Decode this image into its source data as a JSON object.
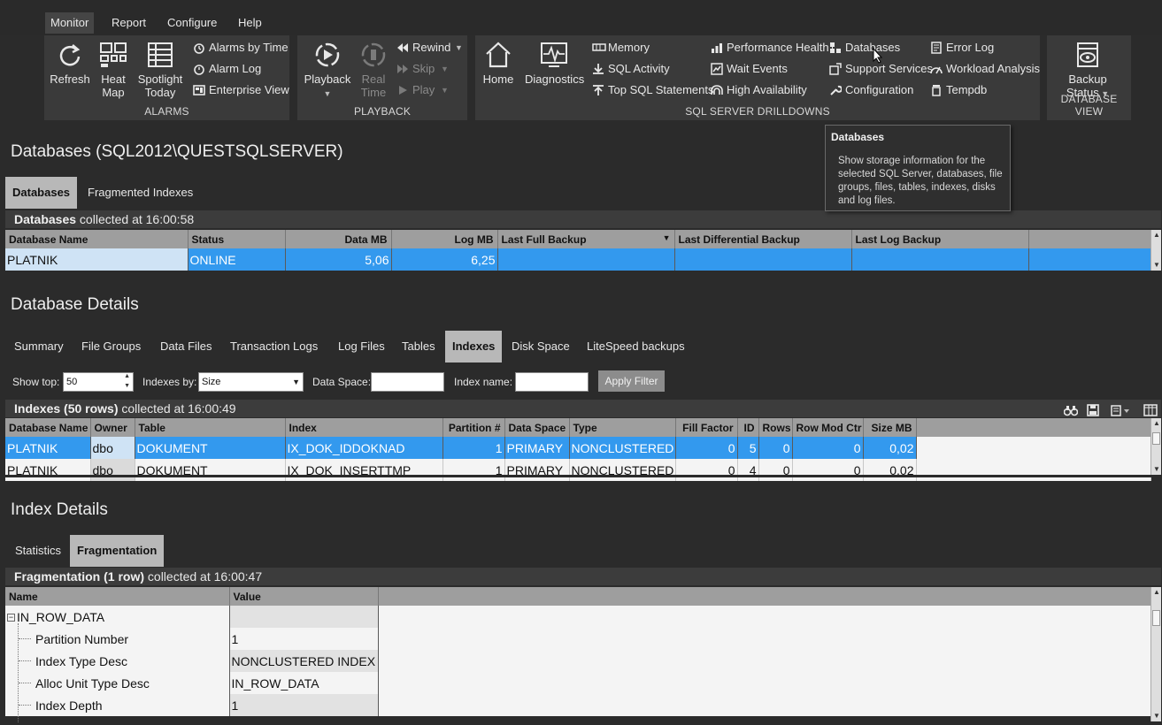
{
  "menu": [
    "Monitor",
    "Report",
    "Configure",
    "Help"
  ],
  "ribbon": {
    "alarms": {
      "caption": "ALARMS",
      "refresh": "Refresh",
      "heatmap": [
        "Heat",
        "Map"
      ],
      "spotlight": [
        "Spotlight",
        "Today"
      ],
      "alarms_by_time": "Alarms by Time",
      "alarm_log": "Alarm Log",
      "enterprise_view": "Enterprise View"
    },
    "playback": {
      "caption": "PLAYBACK",
      "playback": "Playback",
      "realtime": [
        "Real",
        "Time"
      ],
      "rewind": "Rewind",
      "skip": "Skip",
      "play": "Play"
    },
    "drilldowns": {
      "caption": "SQL SERVER DRILLDOWNS",
      "home": "Home",
      "diagnostics": "Diagnostics",
      "memory": "Memory",
      "sql_activity": "SQL Activity",
      "top_sql": "Top SQL Statements",
      "performance_health": "Performance Health",
      "wait_events": "Wait Events",
      "high_availability": "High Availability",
      "databases": "Databases",
      "support_services": "Support Services",
      "configuration": "Configuration",
      "error_log": "Error Log",
      "workload_analysis": "Workload Analysis",
      "tempdb": "Tempdb"
    },
    "dbview": {
      "caption": "DATABASE VIEW",
      "backup_status": [
        "Backup",
        "Status"
      ]
    }
  },
  "tooltip": {
    "title": "Databases",
    "body": "Show storage information for the selected SQL Server, databases, file groups, files, tables, indexes, disks and log files."
  },
  "databases_section": {
    "title": "Databases (SQL2012\\QUESTSQLSERVER)",
    "tabs": [
      "Databases",
      "Fragmented Indexes"
    ],
    "caption_bold": "Databases",
    "caption_rest": " collected at 16:00:58",
    "columns": [
      "Database Name",
      "Status",
      "Data MB",
      "Log MB",
      "Last Full Backup",
      "Last Differential Backup",
      "Last Log Backup"
    ],
    "rows": [
      [
        "PLATNIK",
        "ONLINE",
        "5,06",
        "6,25",
        "",
        "",
        ""
      ]
    ]
  },
  "details_section": {
    "title": "Database Details",
    "tabs": [
      "Summary",
      "File Groups",
      "Data Files",
      "Transaction Logs",
      "Log Files",
      "Tables",
      "Indexes",
      "Disk Space",
      "LiteSpeed backups"
    ],
    "filter": {
      "show_top_label": "Show top:",
      "show_top_value": "50",
      "indexes_by_label": "Indexes by:",
      "indexes_by_value": "Size",
      "data_space_label": "Data Space:",
      "index_name_label": "Index name:",
      "apply": "Apply Filter"
    },
    "caption_bold": "Indexes (50 rows)",
    "caption_rest": " collected at 16:00:49",
    "columns": [
      "Database Name",
      "Owner",
      "Table",
      "Index",
      "Partition #",
      "Data Space",
      "Type",
      "Fill Factor",
      "ID",
      "Rows",
      "Row Mod Ctr",
      "Size MB"
    ],
    "rows": [
      [
        "PLATNIK",
        "dbo",
        "DOKUMENT",
        "IX_DOK_IDDOKNAD",
        "1",
        "PRIMARY",
        "NONCLUSTERED",
        "0",
        "5",
        "0",
        "0",
        "0,02"
      ],
      [
        "PLATNIK",
        "dbo",
        "DOKUMENT",
        "IX_DOK_INSERTTMP",
        "1",
        "PRIMARY",
        "NONCLUSTERED",
        "0",
        "4",
        "0",
        "0",
        "0,02"
      ]
    ]
  },
  "index_section": {
    "title": "Index Details",
    "tabs": [
      "Statistics",
      "Fragmentation"
    ],
    "caption_bold": "Fragmentation (1 row)",
    "caption_rest": " collected at 16:00:47",
    "columns": [
      "Name",
      "Value"
    ],
    "group": "IN_ROW_DATA",
    "rows": [
      [
        "Partition Number",
        "1"
      ],
      [
        "Index Type Desc",
        "NONCLUSTERED INDEX"
      ],
      [
        "Alloc Unit Type Desc",
        "IN_ROW_DATA"
      ],
      [
        "Index Depth",
        "1"
      ]
    ]
  },
  "colors": {
    "selected_row": "#3399ee",
    "header": "#9e9e9e",
    "ribbon_group": "#3a3a3a"
  }
}
